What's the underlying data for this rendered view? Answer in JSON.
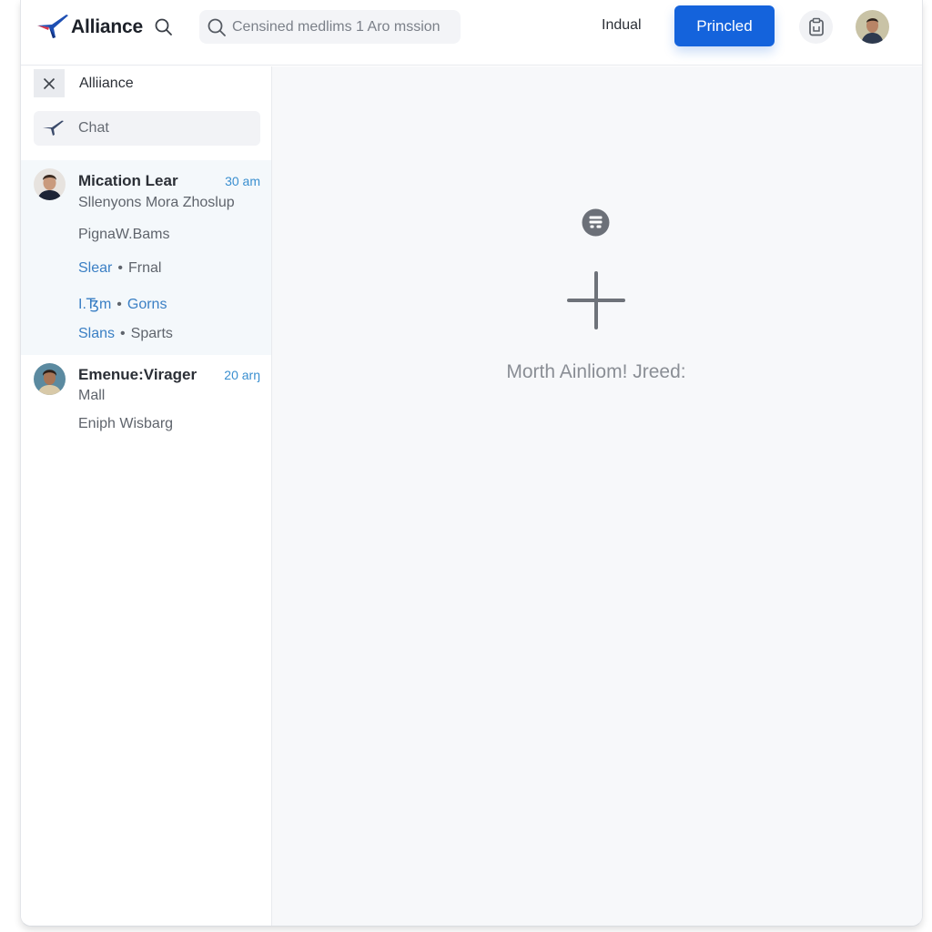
{
  "header": {
    "brand_name": "Alliance",
    "search_placeholder": "Censined medlims 1 Aro mssion",
    "nav_link": "Indual",
    "primary_button": "Princled",
    "icons": {
      "logo": "airplane-logo-icon",
      "header_search": "search-icon",
      "search_box": "search-icon",
      "action": "clipboard-icon",
      "profile": "user-avatar"
    }
  },
  "sidebar": {
    "title": "Alliiance",
    "close_icon": "close-icon",
    "chat_item": {
      "label": "Chat",
      "icon": "paper-plane-icon"
    },
    "conversations": [
      {
        "name": "Mication Lear",
        "time": "30 am",
        "active": true,
        "subtitle": "Sllenyons Mora Zhoslup",
        "preview": "PignaW.Bams",
        "tag_lines": [
          {
            "tag": "Slear",
            "text": "Frnal"
          },
          {
            "tag": "I.Ꜩm",
            "text": "Gorns",
            "text_colored": true
          },
          {
            "tag": "Slans",
            "text": "Sparts"
          }
        ]
      },
      {
        "name": "Emenue:Virager",
        "time": "20 arŋ",
        "active": false,
        "subtitle": "Mall",
        "preview": "Eniph Wisbarg"
      }
    ]
  },
  "main": {
    "empty_state_text": "Morth Ainliom! Jreed:",
    "icons": {
      "top": "list-badge-icon",
      "center": "plus-icon"
    }
  },
  "colors": {
    "primary": "#1463dc",
    "link_blue": "#3a7fc4",
    "time_blue": "#3a8fd0",
    "main_bg": "#f7f8fa",
    "active_row_bg": "#f4f8fb"
  }
}
